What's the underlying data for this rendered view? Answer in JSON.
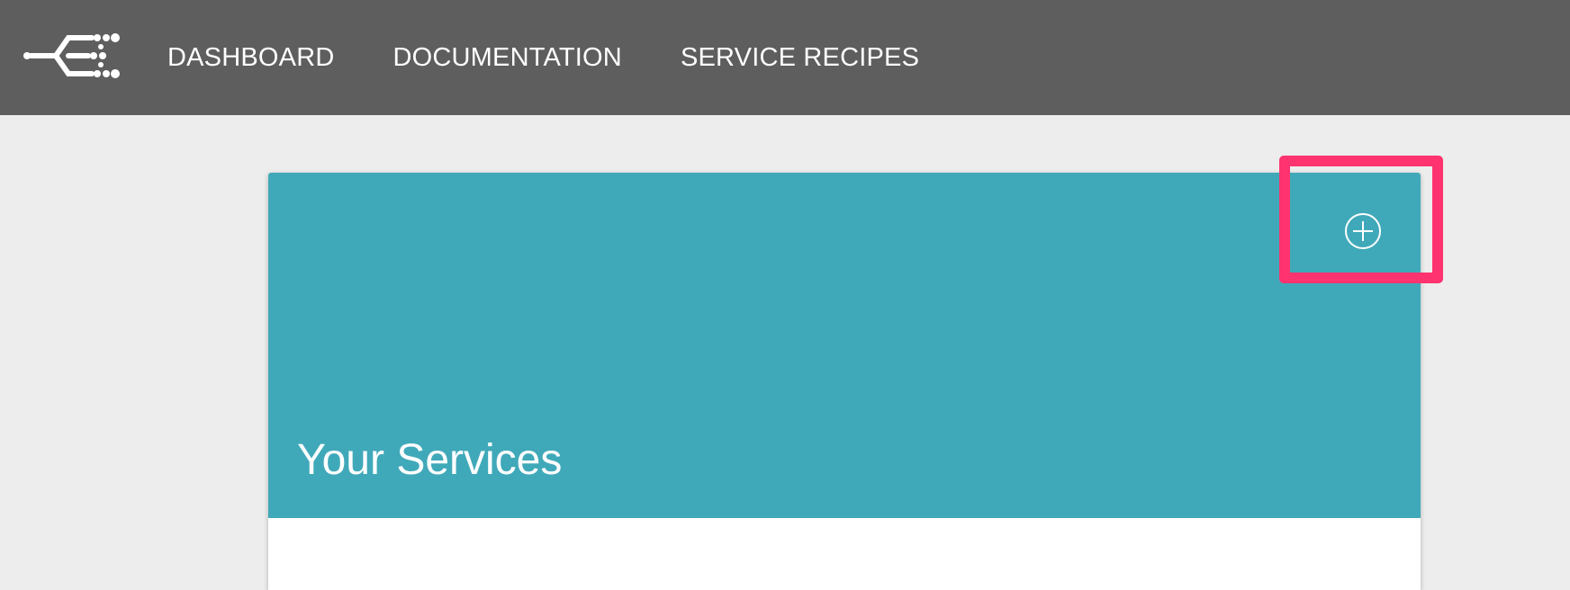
{
  "nav": {
    "items": [
      {
        "label": "DASHBOARD"
      },
      {
        "label": "DOCUMENTATION"
      },
      {
        "label": "SERVICE RECIPES"
      }
    ]
  },
  "card": {
    "title": "Your Services",
    "add_icon": "plus-circle-icon"
  },
  "colors": {
    "topbar": "#5e5e5e",
    "header": "#40a9b9",
    "highlight": "#ff3370",
    "background": "#ededed"
  }
}
